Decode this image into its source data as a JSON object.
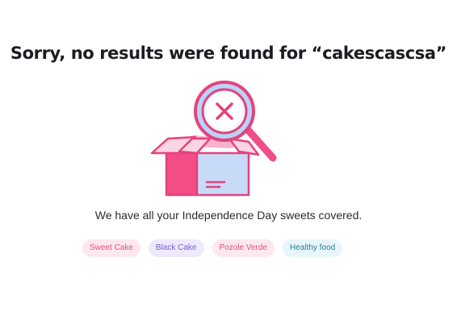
{
  "heading": "Sorry, no results were found for “cakescascsa”",
  "message": "We have all your Independence Day sweets covered.",
  "illustration": {
    "icon": "empty-box-search-icon",
    "colors": {
      "box_front": "#f24d87",
      "box_side": "#c7dbf8",
      "outline": "#e4437c",
      "lens": "#b8d4f8"
    }
  },
  "suggestions": [
    {
      "label": "Sweet Cake",
      "bg": "#fde8ef",
      "color": "#e2507f",
      "name": "chip-sweet-cake"
    },
    {
      "label": "Black Cake",
      "bg": "#efe9fc",
      "color": "#7b5bd8",
      "name": "chip-black-cake"
    },
    {
      "label": "Pozole Verde",
      "bg": "#fde8ef",
      "color": "#e2507f",
      "name": "chip-pozole-verde"
    },
    {
      "label": "Healthy food",
      "bg": "#e6f6fb",
      "color": "#2d7c9a",
      "name": "chip-healthy-food"
    }
  ]
}
